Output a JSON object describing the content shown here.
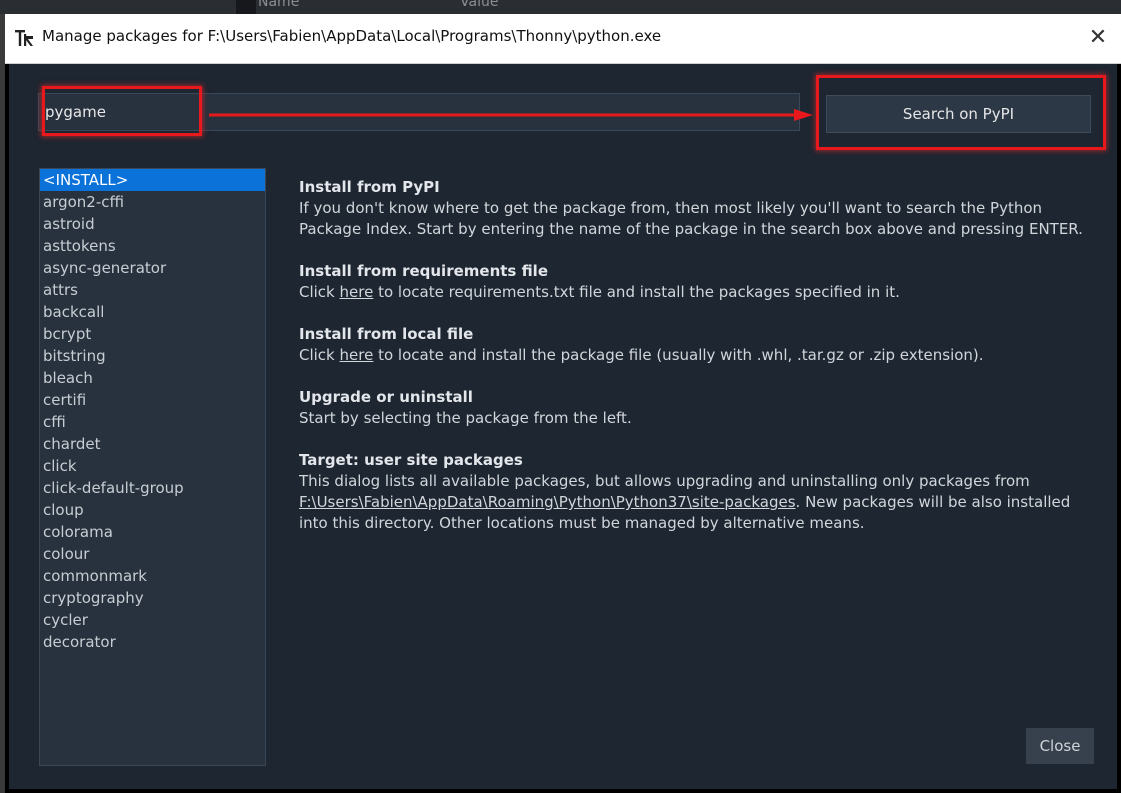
{
  "background": {
    "col_name": "Name",
    "col_value": "Value"
  },
  "window": {
    "title": "Manage packages for F:\\Users\\Fabien\\AppData\\Local\\Programs\\Thonny\\python.exe",
    "close_glyph": "✕"
  },
  "search": {
    "value": "pygame",
    "button_label": "Search on PyPI"
  },
  "packages": [
    "<INSTALL>",
    "argon2-cffi",
    "astroid",
    "asttokens",
    "async-generator",
    "attrs",
    "backcall",
    "bcrypt",
    "bitstring",
    "bleach",
    "certifi",
    "cffi",
    "chardet",
    "click",
    "click-default-group",
    "cloup",
    "colorama",
    "colour",
    "commonmark",
    "cryptography",
    "cycler",
    "decorator"
  ],
  "info": {
    "pypi": {
      "title": "Install from PyPI",
      "body": "If you don't know where to get the package from, then most likely you'll want to search the Python Package Index. Start by entering the name of the package in the search box above and pressing ENTER."
    },
    "requirements": {
      "title": "Install from requirements file",
      "pre": "Click ",
      "link": "here",
      "post": " to locate requirements.txt file and install the packages specified in it."
    },
    "local": {
      "title": "Install from local file",
      "pre": "Click ",
      "link": "here",
      "post": " to locate and install the package file (usually with .whl, .tar.gz or .zip extension)."
    },
    "upgrade": {
      "title": "Upgrade or uninstall",
      "body": "Start by selecting the package from the left."
    },
    "target": {
      "title": "Target:  user site packages",
      "pre": "This dialog lists all available packages, but allows upgrading and uninstalling only packages from ",
      "link": "F:\\Users\\Fabien\\AppData\\Roaming\\Python\\Python37\\site-packages",
      "post": ". New packages will be also installed into this directory. Other locations must be managed by alternative means."
    }
  },
  "close_label": "Close",
  "colors": {
    "dialog_bg": "#1d2631",
    "selected": "#0a72d8",
    "annotation": "#e8191c"
  },
  "icons": {
    "app": "thonny-logo-icon",
    "close": "close-icon"
  }
}
